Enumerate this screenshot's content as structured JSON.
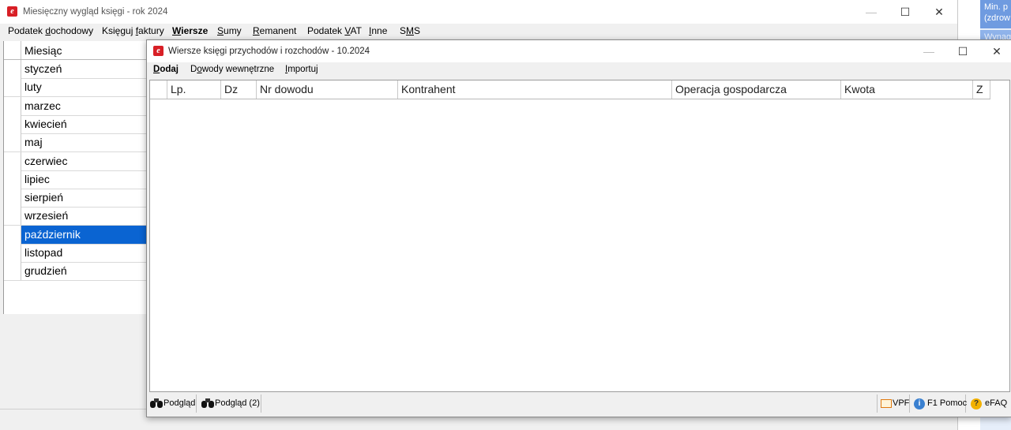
{
  "main_window": {
    "title": "Miesięczny wygląd księgi - rok 2024",
    "menu": [
      {
        "pre": "Podatek ",
        "u": "d",
        "post": "ochodowy"
      },
      {
        "pre": "Księguj ",
        "u": "f",
        "post": "aktury"
      },
      {
        "pre": "",
        "u": "W",
        "post": "iersze"
      },
      {
        "pre": "",
        "u": "S",
        "post": "umy"
      },
      {
        "pre": "",
        "u": "R",
        "post": "emanent"
      },
      {
        "pre": "Podatek ",
        "u": "V",
        "post": "AT"
      },
      {
        "pre": "",
        "u": "I",
        "post": "nne"
      },
      {
        "pre": "S",
        "u": "M",
        "post": "S"
      }
    ],
    "months_header": "Miesiąc",
    "months": [
      "styczeń",
      "luty",
      "marzec",
      "kwiecień",
      "maj",
      "czerwiec",
      "lipiec",
      "sierpień",
      "wrzesień",
      "październik",
      "listopad",
      "grudzień"
    ],
    "selected_month": "październik"
  },
  "right_strip": {
    "line1": "Min. p",
    "line2": "(zdrow",
    "line3": "Wynag"
  },
  "child_window": {
    "title": "Wiersze księgi przychodów i rozchodów - 10.2024",
    "menu": [
      {
        "pre": "",
        "u": "D",
        "post": "odaj",
        "bold": true
      },
      {
        "pre": "D",
        "u": "o",
        "post": "wody wewnętrzne",
        "bold": false
      },
      {
        "pre": "",
        "u": "I",
        "post": "mportuj",
        "bold": false
      }
    ],
    "columns": [
      "Lp.",
      "Dz",
      "Nr dowodu",
      "Kontrahent",
      "Operacja gospodarcza",
      "Kwota",
      "Z"
    ],
    "rows": [],
    "bottom_buttons": {
      "preview": "Podgląd",
      "preview2": "Podgląd (2)",
      "vpf": "VPF",
      "help": "F1 Pomoc",
      "efaq": "eFAQ"
    }
  },
  "colors": {
    "selection": "#0a64d2",
    "app_icon": "#d81f26"
  },
  "icons": [
    "app-logo-icon",
    "minimize-icon",
    "maximize-icon",
    "close-icon",
    "binoculars-icon",
    "vpf-icon",
    "info-icon",
    "question-icon"
  ]
}
